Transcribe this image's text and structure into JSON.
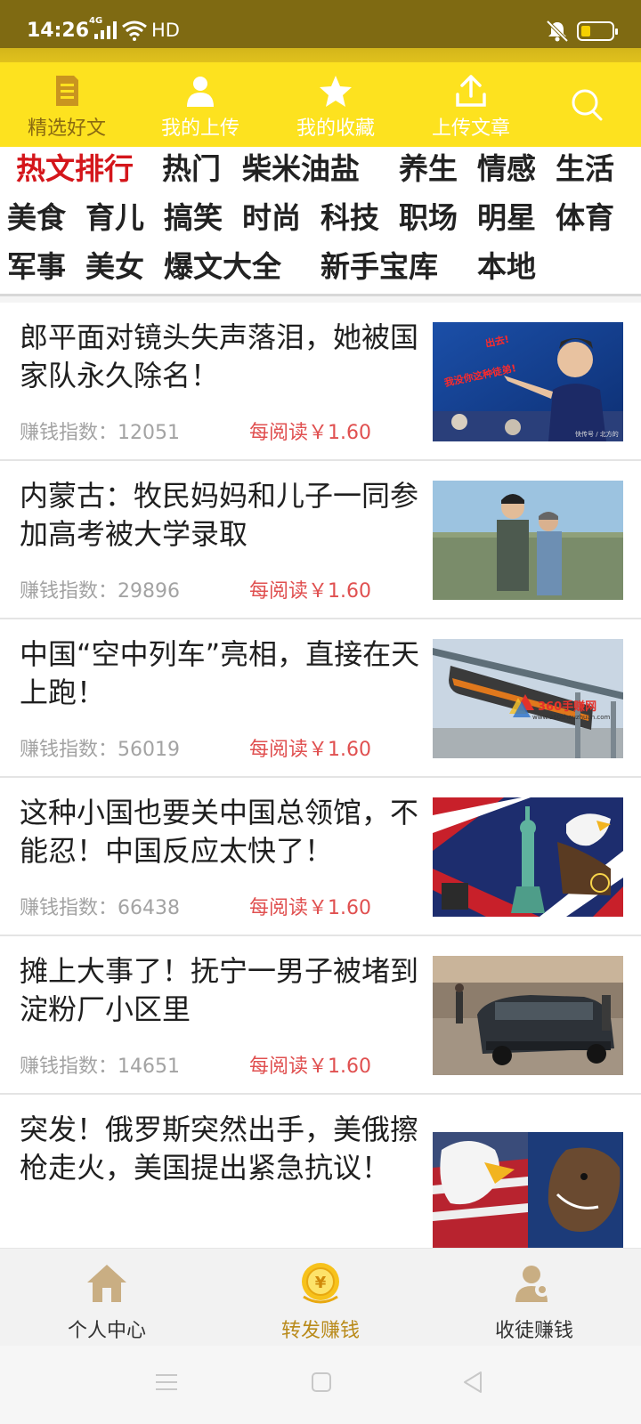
{
  "status": {
    "time": "14:26",
    "network": "4G",
    "hd": "HD"
  },
  "toptabs": [
    {
      "label": "精选好文",
      "icon": "article-icon",
      "active": true
    },
    {
      "label": "我的上传",
      "icon": "user-icon"
    },
    {
      "label": "我的收藏",
      "icon": "star-icon"
    },
    {
      "label": "上传文章",
      "icon": "upload-icon"
    }
  ],
  "categories": {
    "row1": [
      "热文排行",
      "热门",
      "柴米油盐",
      "养生",
      "情感",
      "生活"
    ],
    "row2": [
      "美食",
      "育儿",
      "搞笑",
      "时尚",
      "科技",
      "职场",
      "明星",
      "体育"
    ],
    "row3": [
      "军事",
      "美女",
      "爆文大全",
      "新手宝库",
      "本地"
    ]
  },
  "articles": [
    {
      "title": "郎平面对镜头失声落泪，她被国家队永久除名！",
      "index_label": "赚钱指数：",
      "index": "12051",
      "reward": "每阅读￥1.60",
      "thumb_text": [
        "出去!",
        "我没你这种徒弟!"
      ],
      "thumb_caption": "快传号 / 北方的"
    },
    {
      "title": "内蒙古：牧民妈妈和儿子一同参加高考被大学录取",
      "index_label": "赚钱指数：",
      "index": "29896",
      "reward": "每阅读￥1.60"
    },
    {
      "title": "中国“空中列车”亮相，直接在天上跑！",
      "index_label": "赚钱指数：",
      "index": "56019",
      "reward": "每阅读￥1.60",
      "watermark": "360手赚网",
      "watermark_url": "www.360shouzhuan.com"
    },
    {
      "title": "这种小国也要关中国总领馆，不能忍！中国反应太快了！",
      "index_label": "赚钱指数：",
      "index": "66438",
      "reward": "每阅读￥1.60"
    },
    {
      "title": "摊上大事了！抚宁一男子被堵到淀粉厂小区里",
      "index_label": "赚钱指数：",
      "index": "14651",
      "reward": "每阅读￥1.60"
    },
    {
      "title": "突发！俄罗斯突然出手，美俄擦枪走火，美国提出紧急抗议！",
      "index_label": "",
      "index": "",
      "reward": ""
    }
  ],
  "bottomnav": [
    {
      "label": "个人中心",
      "icon": "home-icon"
    },
    {
      "label": "转发赚钱",
      "icon": "yuan-coin-icon",
      "active": true
    },
    {
      "label": "收徒赚钱",
      "icon": "user-add-icon"
    }
  ],
  "colors": {
    "header_yellow": "#fde21f",
    "accent_brown": "#8a6a12",
    "hot_red": "#d4161b",
    "reward_red": "#e05050"
  }
}
